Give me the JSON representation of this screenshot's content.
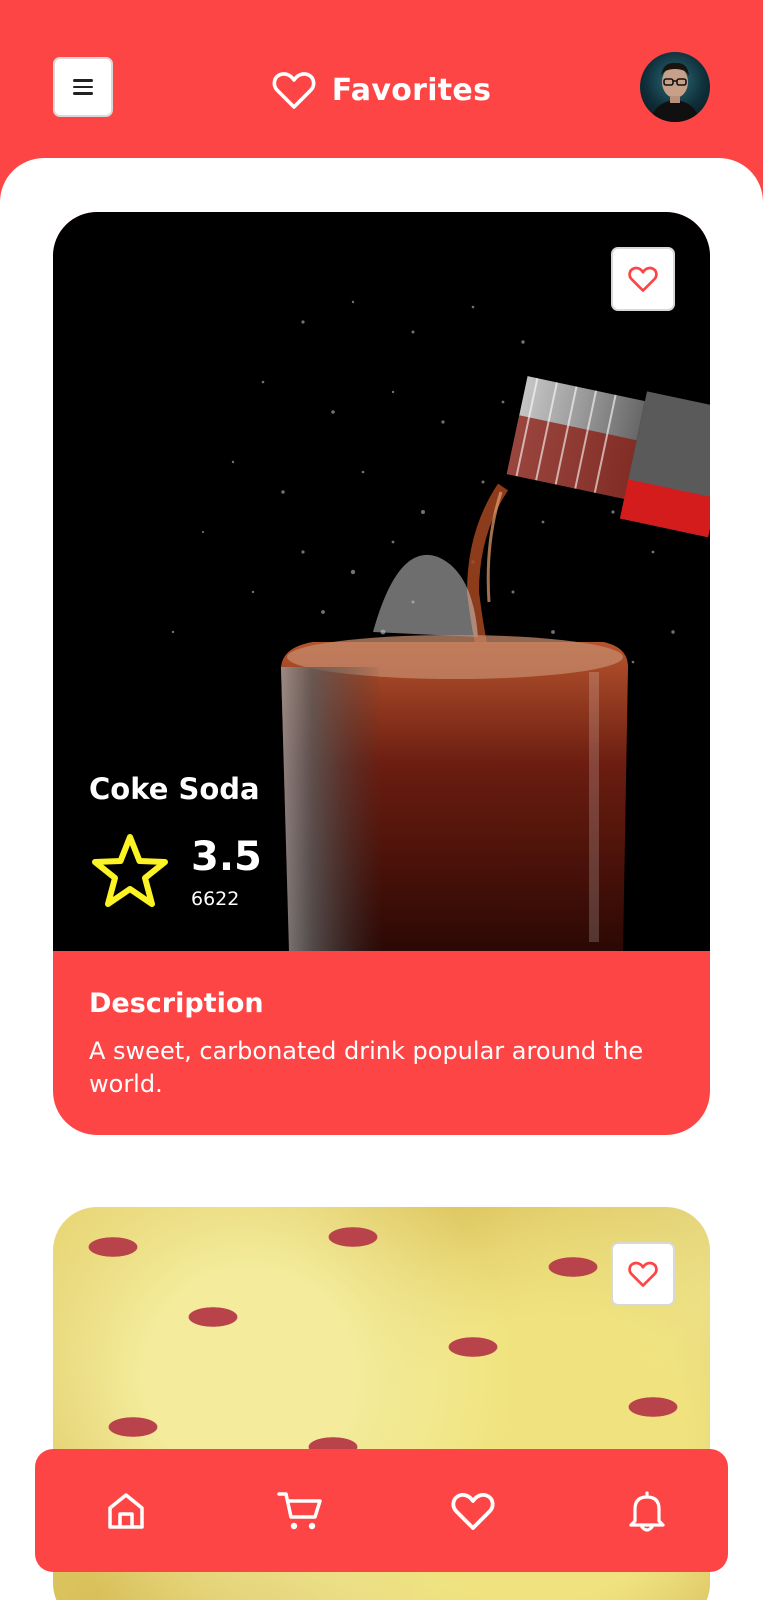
{
  "header": {
    "title": "Favorites",
    "menu_icon": "hamburger-icon",
    "title_icon": "heart-outline-icon",
    "avatar": "user-avatar"
  },
  "colors": {
    "primary": "#fe4545",
    "surface": "#ffffff",
    "star": "#fbf323"
  },
  "favorites": [
    {
      "name": "Coke Soda",
      "rating": "3.5",
      "reviews": "6622",
      "description_title": "Description",
      "description": "A sweet, carbonated drink popular around the world.",
      "favorite_icon": "heart-outline-icon"
    },
    {
      "favorite_icon": "heart-outline-icon"
    }
  ],
  "bottom_nav": [
    {
      "icon": "home-icon"
    },
    {
      "icon": "cart-icon"
    },
    {
      "icon": "heart-icon"
    },
    {
      "icon": "bell-icon"
    }
  ]
}
